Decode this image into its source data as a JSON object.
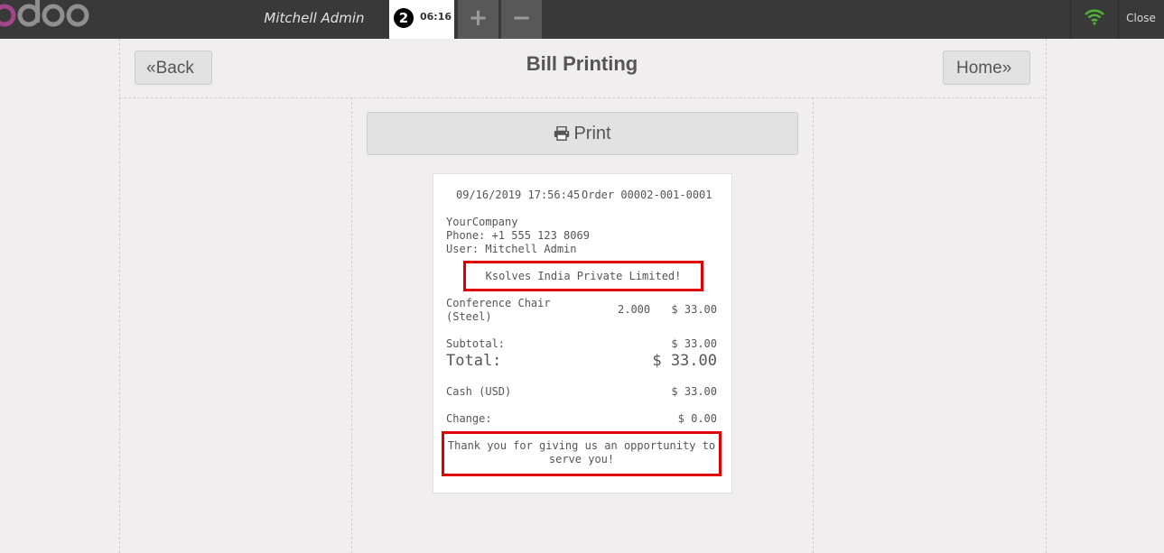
{
  "topbar": {
    "cashier": "Mitchell Admin",
    "order_number": "2",
    "order_time": "06:16",
    "add_order_icon": "plus-icon",
    "remove_order_icon": "minus-icon",
    "connection_icon": "wifi-icon",
    "close_label": "Close",
    "colors": {
      "bar": "#393939",
      "logo_accent": "#a24689",
      "wifi": "#4fb432"
    }
  },
  "screen": {
    "title": "Bill Printing",
    "back_label": "Back",
    "home_label": "Home",
    "print_label": "Print"
  },
  "receipt": {
    "date": "09/16/2019 17:56:45",
    "order": "Order 00002-001-0001",
    "company": "YourCompany",
    "phone": "Phone: +1 555 123 8069",
    "user": "User: Mitchell Admin",
    "header_note": "Ksolves India Private Limited!",
    "lines": [
      {
        "product_line1": "Conference Chair",
        "product_line2": "(Steel)",
        "qty": "2.000",
        "price": "$ 33.00"
      }
    ],
    "subtotal_label": "Subtotal:",
    "subtotal_value": "$ 33.00",
    "total_label": "Total:",
    "total_value": "$ 33.00",
    "payment_label": "Cash (USD)",
    "payment_value": "$ 33.00",
    "change_label": "Change:",
    "change_value": "$ 0.00",
    "footer_line1": "Thank you for giving us an opportunity to",
    "footer_line2": "serve you!",
    "highlight_color": "#e00000"
  }
}
